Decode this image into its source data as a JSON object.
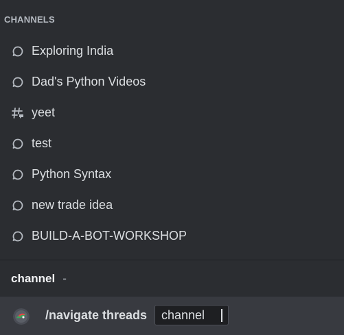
{
  "popup": {
    "section_title": "CHANNELS",
    "items": [
      {
        "label": "Exploring India",
        "icon": "thread-icon"
      },
      {
        "label": "Dad's Python Videos",
        "icon": "thread-icon"
      },
      {
        "label": "yeet",
        "icon": "text-channel-thread-icon"
      },
      {
        "label": "test",
        "icon": "thread-icon"
      },
      {
        "label": "Python Syntax",
        "icon": "thread-icon"
      },
      {
        "label": "new trade idea",
        "icon": "thread-icon"
      },
      {
        "label": "BUILD-A-BOT-WORKSHOP",
        "icon": "thread-icon"
      }
    ]
  },
  "option_hint": {
    "name": "channel",
    "description": "-"
  },
  "input": {
    "command": "/navigate threads",
    "option_label": "channel"
  },
  "colors": {
    "background": "#2b2d31",
    "input_bar": "#383a40",
    "text": "#dbdee1",
    "muted": "#b5bac1"
  }
}
